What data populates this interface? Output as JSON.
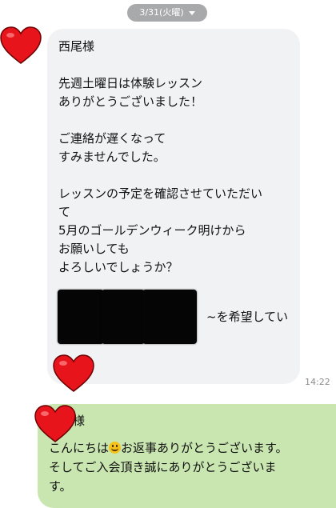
{
  "date_pill": {
    "label": "3/31(火曜)"
  },
  "incoming": {
    "lines": [
      "西尾様",
      "",
      "先週土曜日は体験レッスン",
      "ありがとうございました！",
      "",
      "ご連絡が遅くなって",
      "すみませんでした。",
      "",
      "レッスンの予定を確認させていただい",
      "て",
      "5月のゴールデンウィーク明けから",
      "お願いしても",
      "よろしいでしょうか？"
    ],
    "redacted_tail": "~を希望してい",
    "time": "14:22"
  },
  "outgoing": {
    "name_suffix": "様",
    "line1_before": "こんにちは",
    "line1_after": "お返事ありがとうございます。",
    "line2": "そしてご入会頂き誠にありがとうございま",
    "line3": "す。"
  },
  "icons": {
    "heart": "heart-icon",
    "smile": "smiling-face-emoji"
  },
  "colors": {
    "incoming_bubble": "#f1f2f4",
    "outgoing_bubble": "#c9e6b1",
    "date_pill": "#a8a9ab",
    "heart": "#e8141c"
  }
}
